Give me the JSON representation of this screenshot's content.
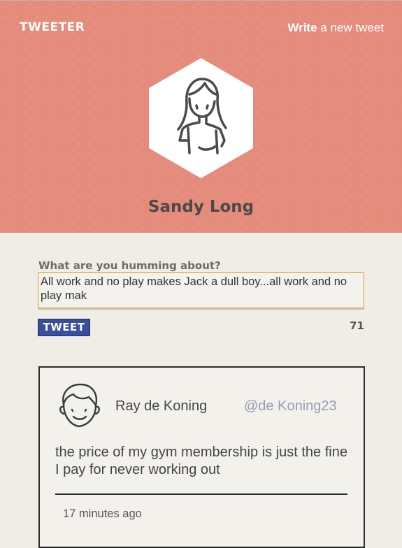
{
  "header": {
    "brand": "TWEETER",
    "write_bold": "Write",
    "write_rest": " a new tweet"
  },
  "profile": {
    "name": "Sandy Long",
    "avatar_icon": "woman-avatar-icon"
  },
  "compose": {
    "label": "What are you humming about?",
    "value": "All work and no play makes Jack a dull boy...all work and no play mak",
    "button_label": "TWEET",
    "remaining_chars": "71"
  },
  "tweets": [
    {
      "author": "Ray de Koning",
      "handle": "@de Koning23",
      "text": "the price of my gym membership is just the fine I pay for never working out",
      "time": "17 minutes ago",
      "avatar_icon": "man-avatar-icon"
    }
  ],
  "colors": {
    "hero": "#e48b7b",
    "background": "#f0ede6",
    "button": "#3a4f9c",
    "input_border": "#dba21f",
    "handle": "#9b9ab2"
  }
}
